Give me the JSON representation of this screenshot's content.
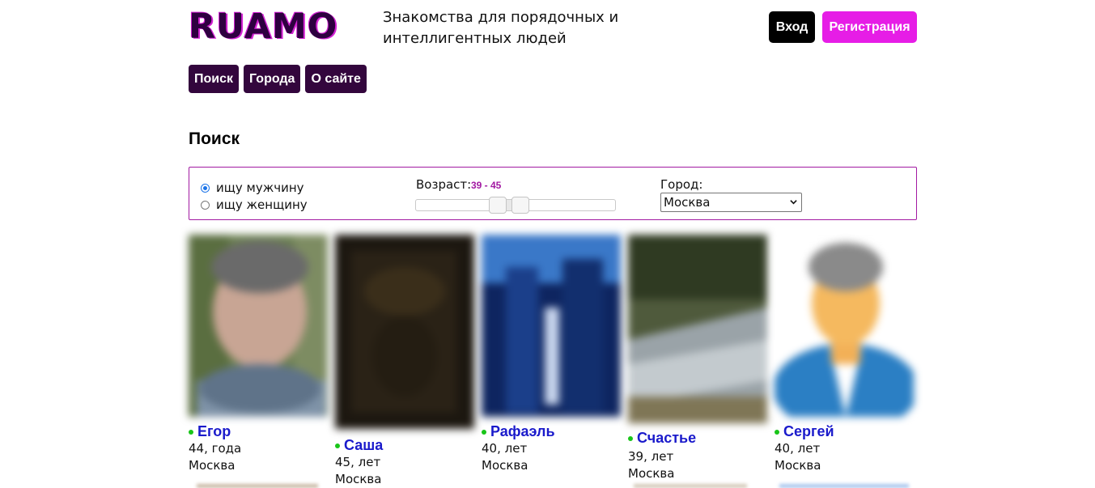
{
  "header": {
    "logo": "RUAMO",
    "tagline": "Знакомства для порядочных и интеллигентных людей",
    "login": "Вход",
    "register": "Регистрация"
  },
  "nav": [
    "Поиск",
    "Города",
    "О сайте"
  ],
  "page_title": "Поиск",
  "filter": {
    "gender_options": [
      "ищу мужчину",
      "ищу женщину"
    ],
    "gender_selected": 0,
    "age_label": "Возраст:",
    "age_range": "39 - 45",
    "age_min": 39,
    "age_max": 45,
    "city_label": "Город:",
    "city_value": "Москва"
  },
  "profiles": [
    {
      "name": "Егор",
      "age": "44, года",
      "city": "Москва",
      "online": true
    },
    {
      "name": "Саша",
      "age": "45, лет",
      "city": "Москва",
      "online": true
    },
    {
      "name": "Рафаэль",
      "age": "40, лет",
      "city": "Москва",
      "online": true
    },
    {
      "name": "Счастье",
      "age": "39, лет",
      "city": "Москва",
      "online": true
    },
    {
      "name": "Сергей",
      "age": "40, лет",
      "city": "Москва",
      "online": true
    }
  ],
  "colors": {
    "brand": "#2e0040",
    "accent": "#e61de6",
    "nav_bg": "#33063d",
    "link": "#1a1acb",
    "online": "#19c519"
  }
}
